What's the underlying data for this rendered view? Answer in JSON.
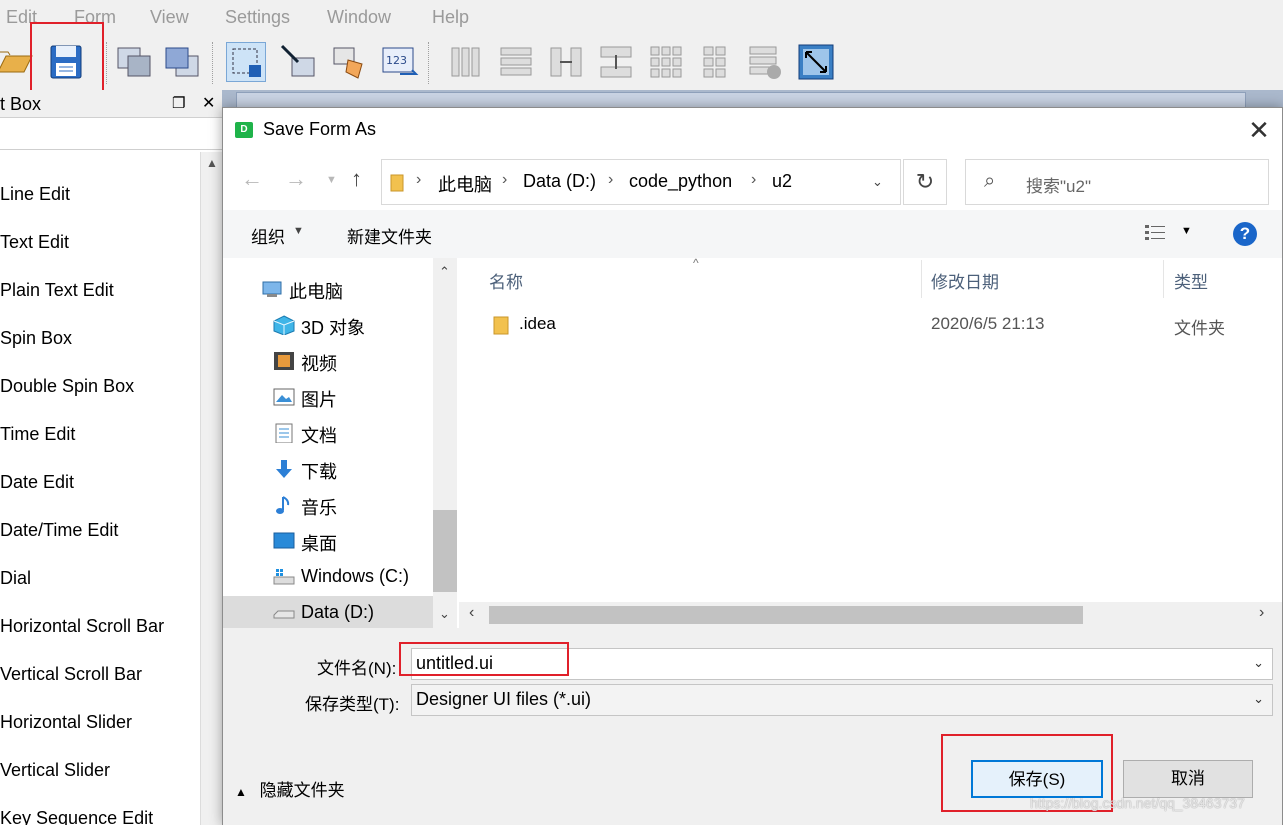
{
  "menubar": {
    "items": [
      "Edit",
      "Form",
      "View",
      "Settings",
      "Window",
      "Help"
    ]
  },
  "widget_box": {
    "title": "t Box",
    "items": [
      "Line Edit",
      "Text Edit",
      "Plain Text Edit",
      "Spin Box",
      "Double Spin Box",
      "Time Edit",
      "Date Edit",
      "Date/Time Edit",
      "Dial",
      "Horizontal Scroll Bar",
      "Vertical Scroll Bar",
      "Horizontal Slider",
      "Vertical Slider",
      "Key Sequence Edit"
    ]
  },
  "dialog": {
    "app_icon_letter": "D",
    "title": "Save Form As",
    "close_glyph": "✕",
    "breadcrumb": [
      "此电脑",
      "Data (D:)",
      "code_python",
      "u2"
    ],
    "search_placeholder": "搜索\"u2\"",
    "organize_label": "组织",
    "new_folder_label": "新建文件夹",
    "help_glyph": "?",
    "nav_tree": [
      {
        "label": "此电脑",
        "icon": "computer-icon"
      },
      {
        "label": "3D 对象",
        "icon": "3d-objects-icon"
      },
      {
        "label": "视频",
        "icon": "video-icon"
      },
      {
        "label": "图片",
        "icon": "pictures-icon"
      },
      {
        "label": "文档",
        "icon": "documents-icon"
      },
      {
        "label": "下载",
        "icon": "downloads-icon"
      },
      {
        "label": "音乐",
        "icon": "music-icon"
      },
      {
        "label": "桌面",
        "icon": "desktop-icon"
      },
      {
        "label": "Windows (C:)",
        "icon": "drive-c-icon"
      },
      {
        "label": "Data (D:)",
        "icon": "drive-d-icon",
        "selected": true
      }
    ],
    "columns": [
      "名称",
      "修改日期",
      "类型"
    ],
    "files": [
      {
        "name": ".idea",
        "modified": "2020/6/5 21:13",
        "type": "文件夹",
        "icon": "folder-icon"
      }
    ],
    "filename_label": "文件名(N):",
    "filename_value": "untitled.ui",
    "filetype_label": "保存类型(T):",
    "filetype_value": "Designer UI files (*.ui)",
    "hide_folders_label": "隐藏文件夹",
    "save_button": "保存(S)",
    "cancel_button": "取消"
  },
  "colors": {
    "highlight_red": "#e0202a",
    "save_button_border": "#0078d7",
    "help_blue": "#1a66c9"
  },
  "watermark": "https://blog.csdn.net/qq_38463737"
}
